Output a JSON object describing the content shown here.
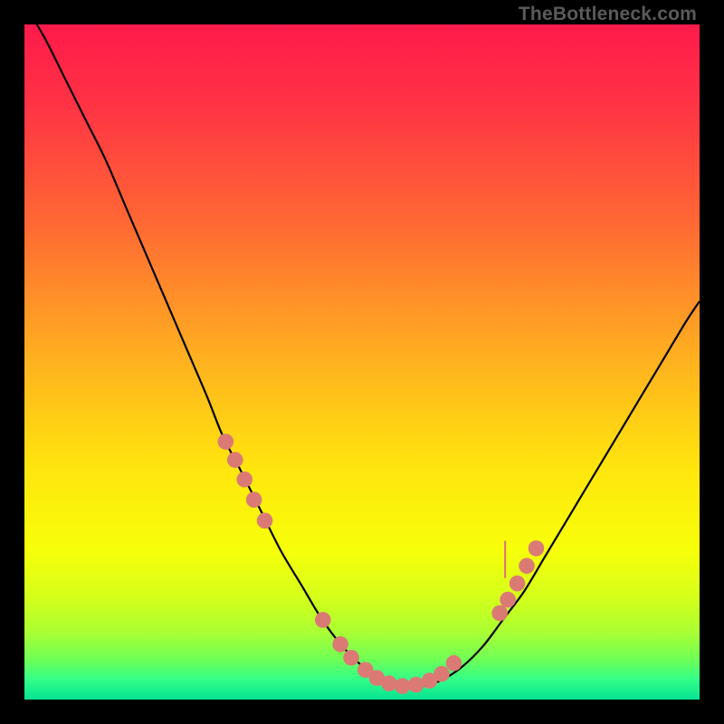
{
  "watermark": "TheBottleneck.com",
  "colors": {
    "frame": "#000000",
    "curve_stroke": "#000000",
    "marker_fill": "#db7a74",
    "gradient_stops": [
      {
        "offset": 0.0,
        "color": "#ff1a4b"
      },
      {
        "offset": 0.12,
        "color": "#ff3344"
      },
      {
        "offset": 0.3,
        "color": "#ff6a33"
      },
      {
        "offset": 0.5,
        "color": "#ffb21f"
      },
      {
        "offset": 0.66,
        "color": "#ffe60d"
      },
      {
        "offset": 0.78,
        "color": "#f7ff0a"
      },
      {
        "offset": 0.85,
        "color": "#d4ff1a"
      },
      {
        "offset": 0.9,
        "color": "#aaff33"
      },
      {
        "offset": 0.94,
        "color": "#70ff55"
      },
      {
        "offset": 0.97,
        "color": "#33ff88"
      },
      {
        "offset": 1.0,
        "color": "#06e293"
      }
    ]
  },
  "chart_data": {
    "type": "line",
    "title": "",
    "xlabel": "",
    "ylabel": "",
    "xlim": [
      0,
      100
    ],
    "ylim": [
      0,
      100
    ],
    "series": [
      {
        "name": "curve",
        "x": [
          0,
          3,
          6,
          9,
          12,
          15,
          18,
          21,
          24,
          27,
          29.4,
          32,
          35,
          38,
          41,
          44,
          47,
          50,
          53,
          56,
          59,
          62,
          65,
          68,
          71,
          74,
          77,
          80,
          83,
          86,
          89,
          92,
          95,
          98,
          100
        ],
        "y": [
          103,
          98,
          92,
          86,
          80,
          73,
          66,
          59,
          52,
          45,
          39,
          34,
          28,
          22,
          17,
          12,
          8,
          5,
          3,
          2,
          2,
          3,
          5,
          8,
          12,
          16,
          21,
          26,
          31,
          36,
          41,
          46,
          51,
          56,
          59
        ]
      }
    ],
    "markers": {
      "name": "highlight-dots",
      "color": "#db7a74",
      "points": [
        {
          "x": 29.8,
          "y": 38.2
        },
        {
          "x": 31.2,
          "y": 35.5
        },
        {
          "x": 32.6,
          "y": 32.6
        },
        {
          "x": 34.0,
          "y": 29.6
        },
        {
          "x": 35.6,
          "y": 26.5
        },
        {
          "x": 44.2,
          "y": 11.8
        },
        {
          "x": 46.8,
          "y": 8.2
        },
        {
          "x": 48.4,
          "y": 6.2
        },
        {
          "x": 50.5,
          "y": 4.4
        },
        {
          "x": 52.2,
          "y": 3.2
        },
        {
          "x": 54.0,
          "y": 2.4
        },
        {
          "x": 56.0,
          "y": 2.0
        },
        {
          "x": 58.0,
          "y": 2.2
        },
        {
          "x": 60.0,
          "y": 2.8
        },
        {
          "x": 61.8,
          "y": 3.8
        },
        {
          "x": 63.6,
          "y": 5.4
        },
        {
          "x": 70.4,
          "y": 12.8
        },
        {
          "x": 71.6,
          "y": 14.8
        },
        {
          "x": 73.0,
          "y": 17.2
        },
        {
          "x": 74.4,
          "y": 19.8
        },
        {
          "x": 75.8,
          "y": 22.4
        }
      ]
    }
  }
}
